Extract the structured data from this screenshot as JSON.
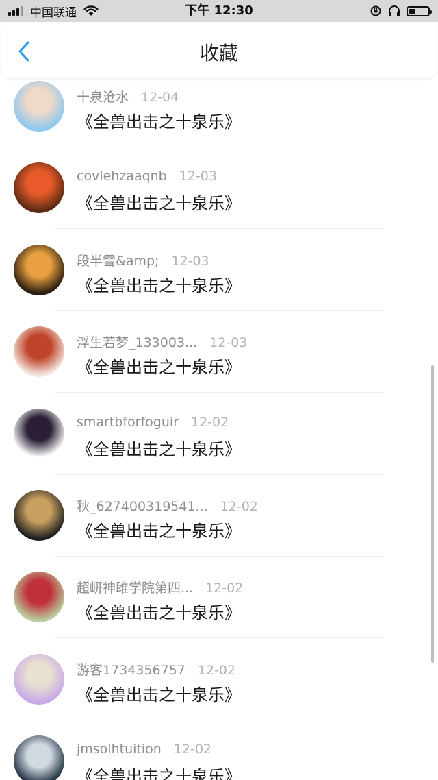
{
  "status_bar": {
    "carrier": "中国联通",
    "time": "下午 12:30",
    "battery_level": 0.35
  },
  "header": {
    "title": "收藏",
    "back_icon": "chevron-left-icon",
    "accent_color": "#2d9bf0"
  },
  "items": [
    {
      "name": "十泉沧水",
      "date": "12-04",
      "title": "《全兽出击之十泉乐》",
      "avatar_colors": [
        "#8ec8ef",
        "#f1d9c7"
      ]
    },
    {
      "name": "covlehzaaqnb",
      "date": "12-03",
      "title": "《全兽出击之十泉乐》",
      "avatar_colors": [
        "#5a2a12",
        "#e85a2a"
      ]
    },
    {
      "name": "段半雪&amp;",
      "date": "12-03",
      "title": "《全兽出击之十泉乐》",
      "avatar_colors": [
        "#2a1c10",
        "#e8a040"
      ]
    },
    {
      "name": "浮生若梦_133003...",
      "date": "12-03",
      "title": "《全兽出击之十泉乐》",
      "avatar_colors": [
        "#f4e6de",
        "#c0442a"
      ]
    },
    {
      "name": "smartbforfoguir",
      "date": "12-02",
      "title": "《全兽出击之十泉乐》",
      "avatar_colors": [
        "#ffffff",
        "#2a1f35"
      ]
    },
    {
      "name": "秋_627400319541...",
      "date": "12-02",
      "title": "《全兽出击之十泉乐》",
      "avatar_colors": [
        "#1e1e1e",
        "#c8a060"
      ]
    },
    {
      "name": "超岍神雎学院第四...",
      "date": "12-02",
      "title": "《全兽出击之十泉乐》",
      "avatar_colors": [
        "#b8d0a0",
        "#c0303a"
      ]
    },
    {
      "name": "游客1734356757",
      "date": "12-02",
      "title": "《全兽出击之十泉乐》",
      "avatar_colors": [
        "#c8a8e8",
        "#e8e0d0"
      ]
    },
    {
      "name": "jmsolhtuition",
      "date": "12-02",
      "title": "《全兽出击之十泉乐》",
      "avatar_colors": [
        "#203040",
        "#d0d8e0"
      ]
    }
  ]
}
